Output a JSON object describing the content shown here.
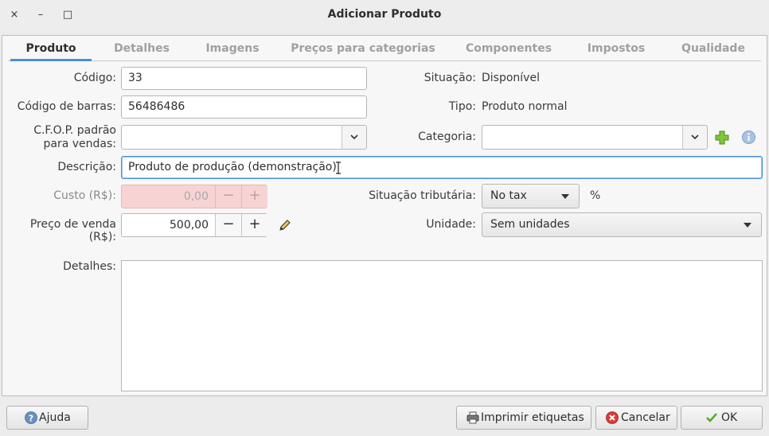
{
  "window": {
    "title": "Adicionar Produto",
    "controls": {
      "close": "×",
      "minimize": "–",
      "maximize": "□"
    }
  },
  "tabs": [
    {
      "label": "Produto",
      "active": true
    },
    {
      "label": "Detalhes",
      "active": false
    },
    {
      "label": "Imagens",
      "active": false
    },
    {
      "label": "Preços para categorias",
      "active": false
    },
    {
      "label": "Componentes",
      "active": false
    },
    {
      "label": "Impostos",
      "active": false
    },
    {
      "label": "Qualidade",
      "active": false
    }
  ],
  "form": {
    "codigo": {
      "label": "Código:",
      "value": "33"
    },
    "codigo_barras": {
      "label": "Código de barras:",
      "value": "56486486"
    },
    "cfop": {
      "label_line1": "C.F.O.P. padrão",
      "label_line2": "para vendas:",
      "value": ""
    },
    "descricao": {
      "label": "Descrição:",
      "value": "Produto de produção (demonstração)"
    },
    "custo": {
      "label": "Custo (R$):",
      "value": "0,00",
      "minus": "−",
      "plus": "+"
    },
    "preco_venda": {
      "label": "Preço de venda (R$):",
      "value": "500,00",
      "minus": "−",
      "plus": "+"
    },
    "situacao": {
      "label": "Situação:",
      "value": "Disponível"
    },
    "tipo": {
      "label": "Tipo:",
      "value": "Produto normal"
    },
    "categoria": {
      "label": "Categoria:",
      "value": ""
    },
    "situacao_tributaria": {
      "label": "Situação tributária:",
      "value": "No tax",
      "suffix": "%"
    },
    "unidade": {
      "label": "Unidade:",
      "value": "Sem unidades"
    },
    "detalhes": {
      "label": "Detalhes:",
      "value": ""
    }
  },
  "icons": {
    "add_category": "plus-icon",
    "category_info": "info-icon",
    "edit_price": "pencil-icon"
  },
  "buttons": {
    "help": "Ajuda",
    "print_labels": "Imprimir etiquetas",
    "cancel": "Cancelar",
    "ok": "OK"
  },
  "colors": {
    "accent": "#4a90d9",
    "disabled_field": "#f8d3d3",
    "add_icon": "#6cbf2a",
    "cancel_icon": "#d83b3b",
    "ok_icon": "#5aaa2a"
  }
}
